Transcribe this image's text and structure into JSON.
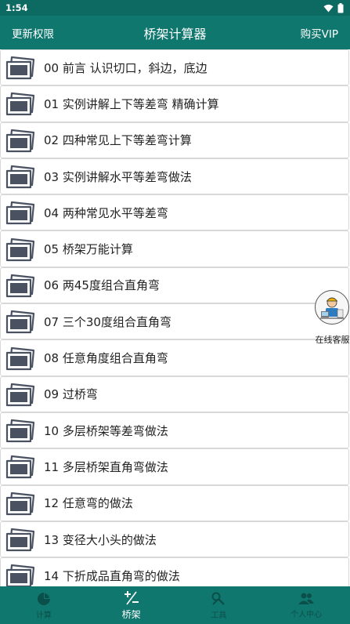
{
  "status_bar": {
    "time": "1:54"
  },
  "app_bar": {
    "left_label": "更新权限",
    "title": "桥架计算器",
    "right_label": "购买VIP"
  },
  "list": {
    "items": [
      {
        "label": "00 前言 认识切口，斜边，底边"
      },
      {
        "label": "01 实例讲解上下等差弯 精确计算"
      },
      {
        "label": "02 四种常见上下等差弯计算"
      },
      {
        "label": "03 实例讲解水平等差弯做法"
      },
      {
        "label": "04 两种常见水平等差弯"
      },
      {
        "label": "05 桥架万能计算"
      },
      {
        "label": "06 两45度组合直角弯"
      },
      {
        "label": "07 三个30度组合直角弯"
      },
      {
        "label": "08 任意角度组合直角弯"
      },
      {
        "label": "09 过桥弯"
      },
      {
        "label": "10 多层桥架等差弯做法"
      },
      {
        "label": "11 多层桥架直角弯做法"
      },
      {
        "label": "12 任意弯的做法"
      },
      {
        "label": "13 变径大小头的做法"
      },
      {
        "label": "14 下折成品直角弯的做法"
      }
    ]
  },
  "float_service": {
    "caption": "在线客服"
  },
  "bottom_nav": {
    "tabs": [
      {
        "label": "计算",
        "icon": "pie-chart-icon"
      },
      {
        "label": "桥架",
        "icon": "plus-minus-icon"
      },
      {
        "label": "工具",
        "icon": "tools-icon"
      },
      {
        "label": "个人中心",
        "icon": "people-icon"
      }
    ],
    "active_index": 1
  },
  "colors": {
    "primary": "#10776f",
    "status_bar": "#0d6a63",
    "inactive_tab": "#0b4f4a",
    "active_tab": "#ffffff"
  }
}
